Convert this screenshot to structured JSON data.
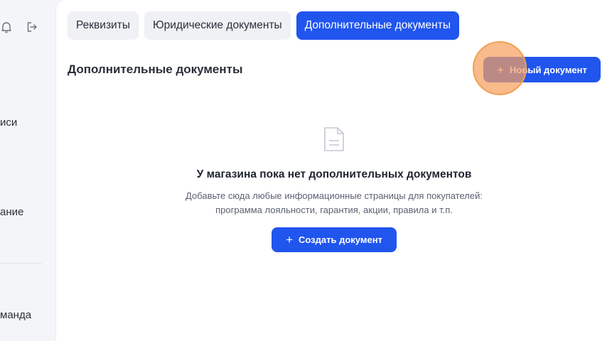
{
  "sidebar": {
    "icons": {
      "notifications": "bell-icon",
      "logout": "logout-icon"
    },
    "items": [
      {
        "label": "иси"
      },
      {
        "label": "ание"
      },
      {
        "label": "манда"
      }
    ]
  },
  "tabs": [
    {
      "label": "Реквизиты",
      "active": false
    },
    {
      "label": "Юридические документы",
      "active": false
    },
    {
      "label": "Дополнительные документы",
      "active": true
    }
  ],
  "section": {
    "title": "Дополнительные документы",
    "new_button": {
      "icon": "plus-icon",
      "label": "Новый документ"
    }
  },
  "empty_state": {
    "icon": "document-icon",
    "title": "У магазина пока нет дополнительных документов",
    "description_line1": "Добавьте сюда любые информационные страницы для покупателей:",
    "description_line2": "программа лояльности, гарантия, акции, правила и т.п.",
    "create_button": {
      "icon": "plus-icon",
      "label": "Создать документ"
    }
  },
  "colors": {
    "accent": "#2055ee",
    "tab_bg": "#eff1f5",
    "page_bg": "#f4f5f8",
    "click_marker": "#f6a060"
  }
}
